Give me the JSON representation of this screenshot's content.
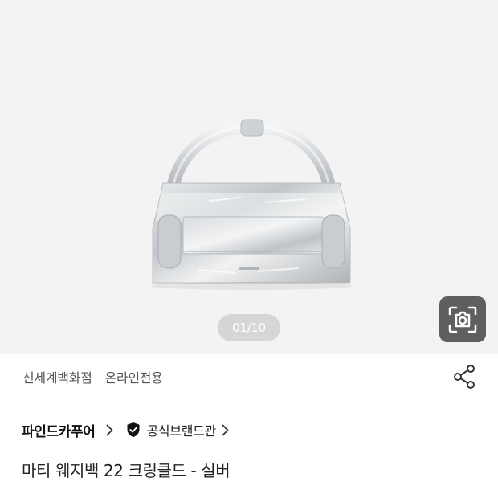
{
  "gallery": {
    "page_indicator": "01/10",
    "image_icon": "silver-handbag-image",
    "lens_icon": "camera-lens-icon"
  },
  "store": {
    "tags": [
      "신세계백화점",
      "온라인전용"
    ],
    "share_icon": "share-icon"
  },
  "brand": {
    "name": "파인드카푸어",
    "official_label": "공식브랜드관",
    "official_icon": "verified-shield-icon"
  },
  "product": {
    "title": "마티 웨지백 22 크링클드 - 실버"
  },
  "colors": {
    "hero_background": "#f3f3f3",
    "indicator_background": "#d6d6d6",
    "lens_button_background": "#5f5f5f"
  }
}
